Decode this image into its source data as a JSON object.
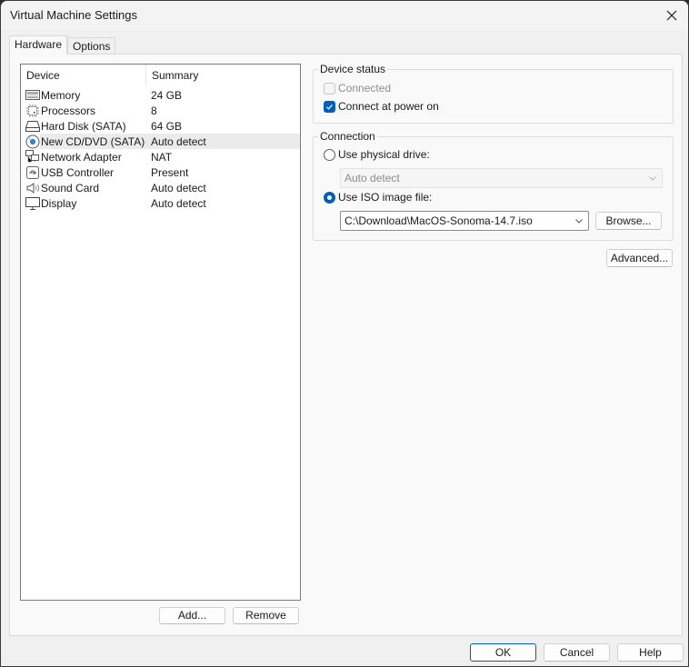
{
  "window": {
    "title": "Virtual Machine Settings",
    "close_icon": "close-icon"
  },
  "tabs": [
    {
      "label": "Hardware",
      "active": true
    },
    {
      "label": "Options",
      "active": false
    }
  ],
  "device_list": {
    "columns": {
      "device": "Device",
      "summary": "Summary"
    },
    "rows": [
      {
        "icon": "memory-icon",
        "name": "Memory",
        "summary": "24 GB",
        "selected": false
      },
      {
        "icon": "processor-icon",
        "name": "Processors",
        "summary": "8",
        "selected": false
      },
      {
        "icon": "hard-disk-icon",
        "name": "Hard Disk (SATA)",
        "summary": "64 GB",
        "selected": false
      },
      {
        "icon": "cd-dvd-icon",
        "name": "New CD/DVD (SATA)",
        "summary": "Auto detect",
        "selected": true
      },
      {
        "icon": "network-adapter-icon",
        "name": "Network Adapter",
        "summary": "NAT",
        "selected": false
      },
      {
        "icon": "usb-icon",
        "name": "USB Controller",
        "summary": "Present",
        "selected": false
      },
      {
        "icon": "sound-card-icon",
        "name": "Sound Card",
        "summary": "Auto detect",
        "selected": false
      },
      {
        "icon": "display-icon",
        "name": "Display",
        "summary": "Auto detect",
        "selected": false
      }
    ],
    "add_label": "Add...",
    "remove_label": "Remove"
  },
  "device_status": {
    "label": "Device status",
    "connected": {
      "label": "Connected",
      "checked": false,
      "disabled": true
    },
    "connect_at_power_on": {
      "label": "Connect at power on",
      "checked": true,
      "disabled": false
    }
  },
  "connection": {
    "label": "Connection",
    "physical_drive": {
      "label": "Use physical drive:",
      "selected": false,
      "value": "Auto detect"
    },
    "iso_image": {
      "label": "Use ISO image file:",
      "selected": true,
      "value": "C:\\Download\\MacOS-Sonoma-14.7.iso"
    },
    "browse_label": "Browse...",
    "advanced_label": "Advanced..."
  },
  "footer": {
    "ok_label": "OK",
    "cancel_label": "Cancel",
    "help_label": "Help"
  },
  "colors": {
    "accent": "#005fb8",
    "selected_row": "#ebebeb"
  }
}
